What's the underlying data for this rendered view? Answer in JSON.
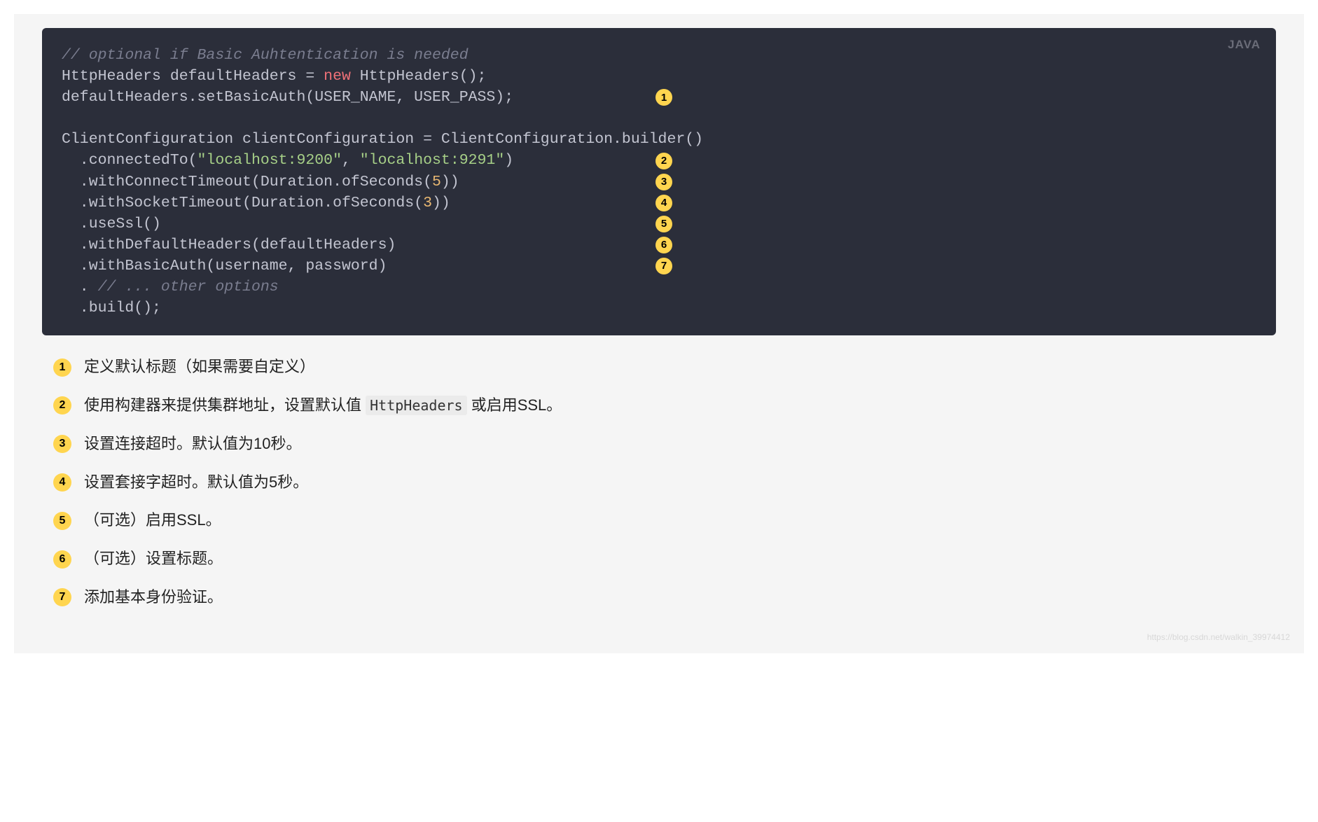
{
  "lang_badge": "JAVA",
  "code": {
    "l1_comment": "// optional if Basic Auhtentication is needed",
    "l2_a": "HttpHeaders defaultHeaders = ",
    "l2_new": "new",
    "l2_b": " HttpHeaders();",
    "l3": "defaultHeaders.setBasicAuth(USER_NAME, USER_PASS);",
    "l5": "ClientConfiguration clientConfiguration = ClientConfiguration.builder()",
    "l6_a": "  .connectedTo(",
    "l6_s1": "\"localhost:9200\"",
    "l6_c1": ", ",
    "l6_s2": "\"localhost:9291\"",
    "l6_b": ")",
    "l7_a": "  .withConnectTimeout(Duration.ofSeconds(",
    "l7_n": "5",
    "l7_b": "))",
    "l8_a": "  .withSocketTimeout(Duration.ofSeconds(",
    "l8_n": "3",
    "l8_b": "))",
    "l9": "  .useSsl()",
    "l10": "  .withDefaultHeaders(defaultHeaders)",
    "l11": "  .withBasicAuth(username, password)",
    "l12_a": "  . ",
    "l12_comment": "// ... other options",
    "l13": "  .build();"
  },
  "badges": {
    "b1": "1",
    "b2": "2",
    "b3": "3",
    "b4": "4",
    "b5": "5",
    "b6": "6",
    "b7": "7"
  },
  "callouts": {
    "c1": {
      "num": "1",
      "text": "定义默认标题（如果需要自定义）"
    },
    "c2": {
      "num": "2",
      "pre": "使用构建器来提供集群地址，设置默认值 ",
      "code": "HttpHeaders",
      "post": " 或启用SSL。"
    },
    "c3": {
      "num": "3",
      "text": "设置连接超时。默认值为10秒。"
    },
    "c4": {
      "num": "4",
      "text": "设置套接字超时。默认值为5秒。"
    },
    "c5": {
      "num": "5",
      "text": "（可选）启用SSL。"
    },
    "c6": {
      "num": "6",
      "text": "（可选）设置标题。"
    },
    "c7": {
      "num": "7",
      "text": "添加基本身份验证。"
    }
  },
  "watermark": "https://blog.csdn.net/walkin_39974412"
}
